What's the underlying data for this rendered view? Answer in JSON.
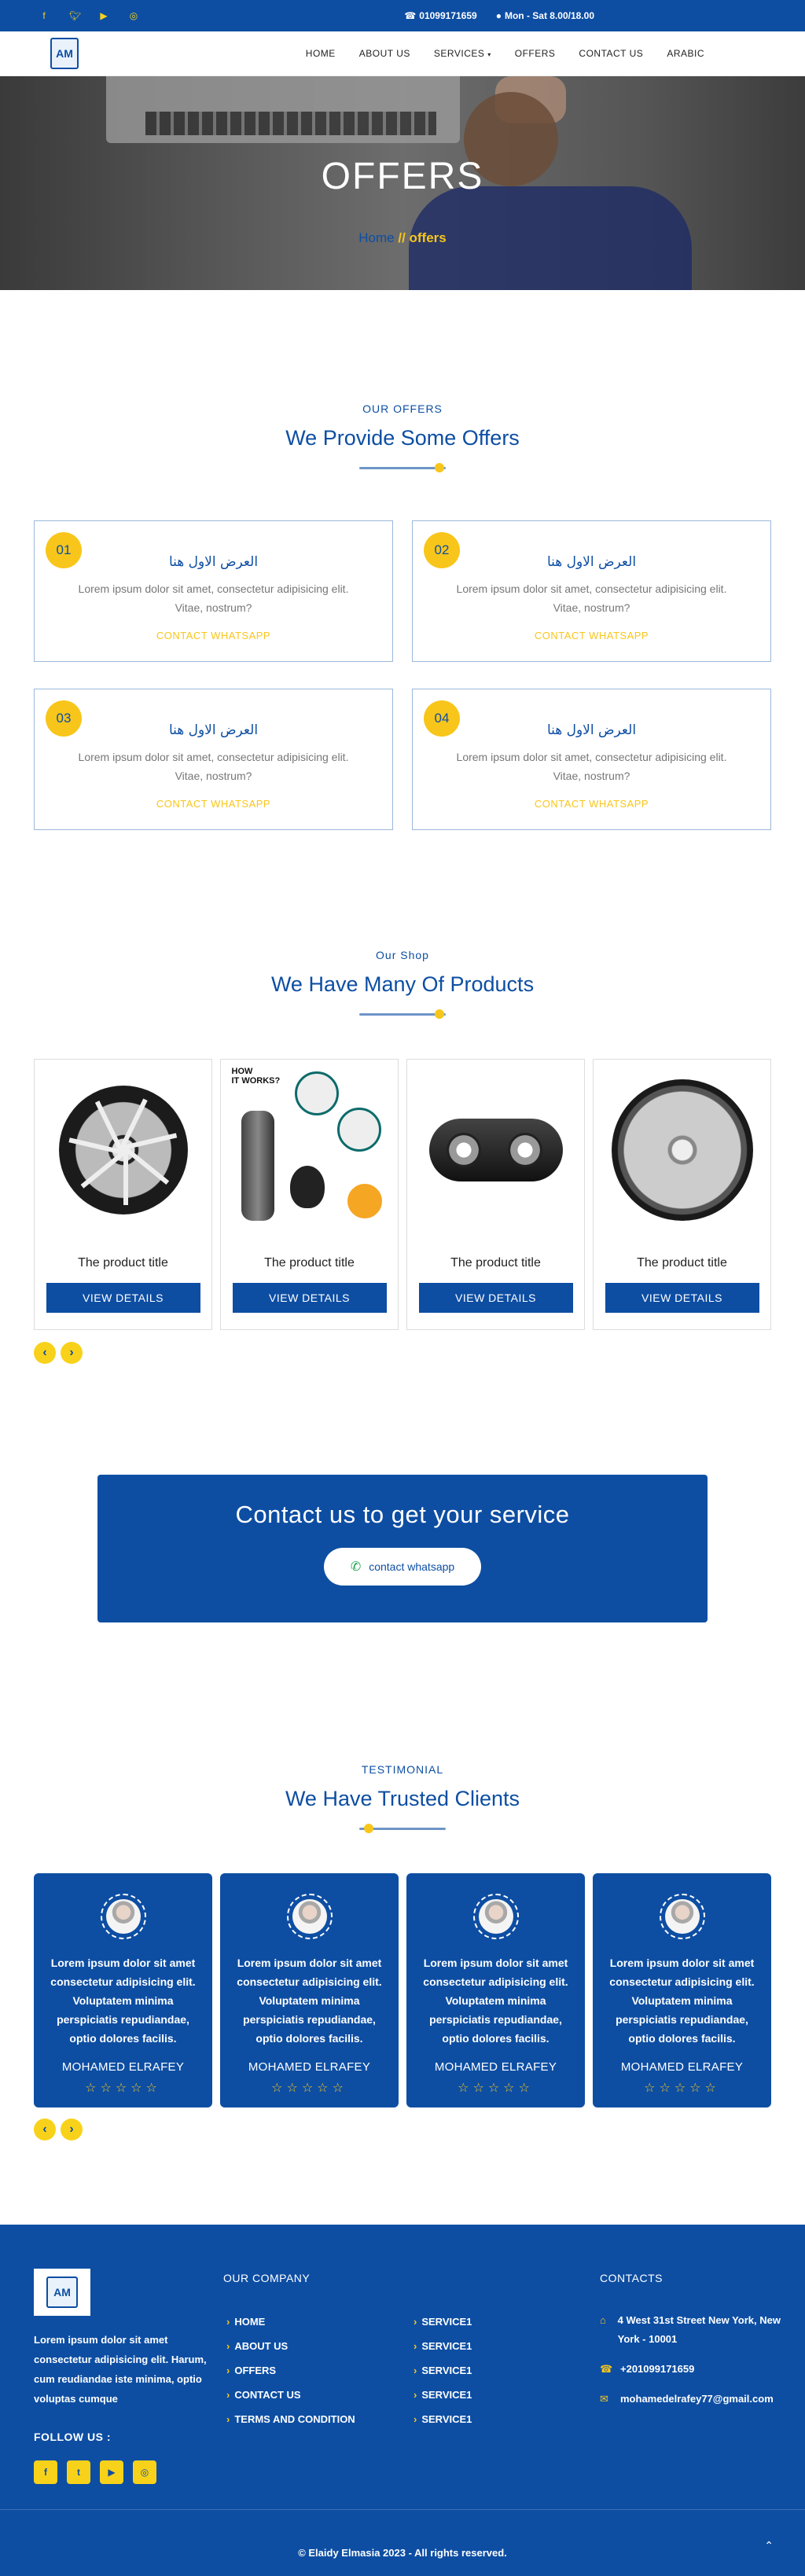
{
  "topbar": {
    "social_icons": [
      "facebook-icon",
      "twitter-icon",
      "youtube-icon",
      "instagram-icon"
    ],
    "phone": "01099171659",
    "hours": "Mon - Sat 8.00/18.00"
  },
  "nav": {
    "items": [
      "HOME",
      "ABOUT US",
      "SERVICES",
      "OFFERS",
      "CONTACT US",
      "ARABIC"
    ]
  },
  "hero": {
    "title": "OFFERS",
    "crumb_home": "Home",
    "crumb_current": "// offers"
  },
  "offers": {
    "subtitle": "OUR OFFERS",
    "title": "We Provide Some Offers",
    "items": [
      {
        "num": "01",
        "title": "العرض الاول هنا",
        "desc": "Lorem ipsum dolor sit amet, consectetur adipisicing elit. Vitae, nostrum?",
        "cta": "CONTACT WHATSAPP"
      },
      {
        "num": "02",
        "title": "العرض الاول هنا",
        "desc": "Lorem ipsum dolor sit amet, consectetur adipisicing elit. Vitae, nostrum?",
        "cta": "CONTACT WHATSAPP"
      },
      {
        "num": "03",
        "title": "العرض الاول هنا",
        "desc": "Lorem ipsum dolor sit amet, consectetur adipisicing elit. Vitae, nostrum?",
        "cta": "CONTACT WHATSAPP"
      },
      {
        "num": "04",
        "title": "العرض الاول هنا",
        "desc": "Lorem ipsum dolor sit amet, consectetur adipisicing elit. Vitae, nostrum?",
        "cta": "CONTACT WHATSAPP"
      }
    ]
  },
  "products": {
    "subtitle": "Our Shop",
    "title": "We Have Many Of Products",
    "items": [
      {
        "title": "The product title",
        "button": "VIEW DETAILS"
      },
      {
        "title": "The product title",
        "button": "VIEW DETAILS",
        "image_text": "HOW\nIT WORKS?"
      },
      {
        "title": "The product title",
        "button": "VIEW DETAILS"
      },
      {
        "title": "The product title",
        "button": "VIEW DETAILS"
      }
    ]
  },
  "cta": {
    "title": "Contact us to get your service",
    "button": "contact whatsapp"
  },
  "testimonials": {
    "subtitle": "TESTIMONIAL",
    "title": "We Have Trusted Clients",
    "items": [
      {
        "text": "Lorem ipsum dolor sit amet consectetur adipisicing elit. Voluptatem minima perspiciatis repudiandae, optio dolores facilis.",
        "name": "MOHAMED ELRAFEY",
        "rating": 5
      },
      {
        "text": "Lorem ipsum dolor sit amet consectetur adipisicing elit. Voluptatem minima perspiciatis repudiandae, optio dolores facilis.",
        "name": "MOHAMED ELRAFEY",
        "rating": 5
      },
      {
        "text": "Lorem ipsum dolor sit amet consectetur adipisicing elit. Voluptatem minima perspiciatis repudiandae, optio dolores facilis.",
        "name": "MOHAMED ELRAFEY",
        "rating": 5
      },
      {
        "text": "Lorem ipsum dolor sit amet consectetur adipisicing elit. Voluptatem minima perspiciatis repudiandae, optio dolores facilis.",
        "name": "MOHAMED ELRAFEY",
        "rating": 5
      }
    ]
  },
  "footer": {
    "description": "Lorem ipsum dolor sit amet consectetur adipisicing elit. Harum, cum reudiandae iste minima, optio voluptas cumque",
    "follow": "FOLLOW US :",
    "company_heading": "OUR COMPANY",
    "company_links": [
      "HOME",
      "ABOUT US",
      "OFFERS",
      "CONTACT US",
      "TERMS AND CONDITION"
    ],
    "service_links": [
      "SERVICE1",
      "SERVICE1",
      "SERVICE1",
      "SERVICE1",
      "SERVICE1"
    ],
    "contacts_heading": "CONTACTS",
    "address": "4 West 31st Street New York, New York - 10001",
    "phone": "+201099171659",
    "email": "mohamedelrafey77@gmail.com",
    "copyright": "© Elaidy Elmasia 2023 - All rights reserved."
  },
  "colors": {
    "primary": "#0d4ea3",
    "accent": "#f8c61a"
  }
}
